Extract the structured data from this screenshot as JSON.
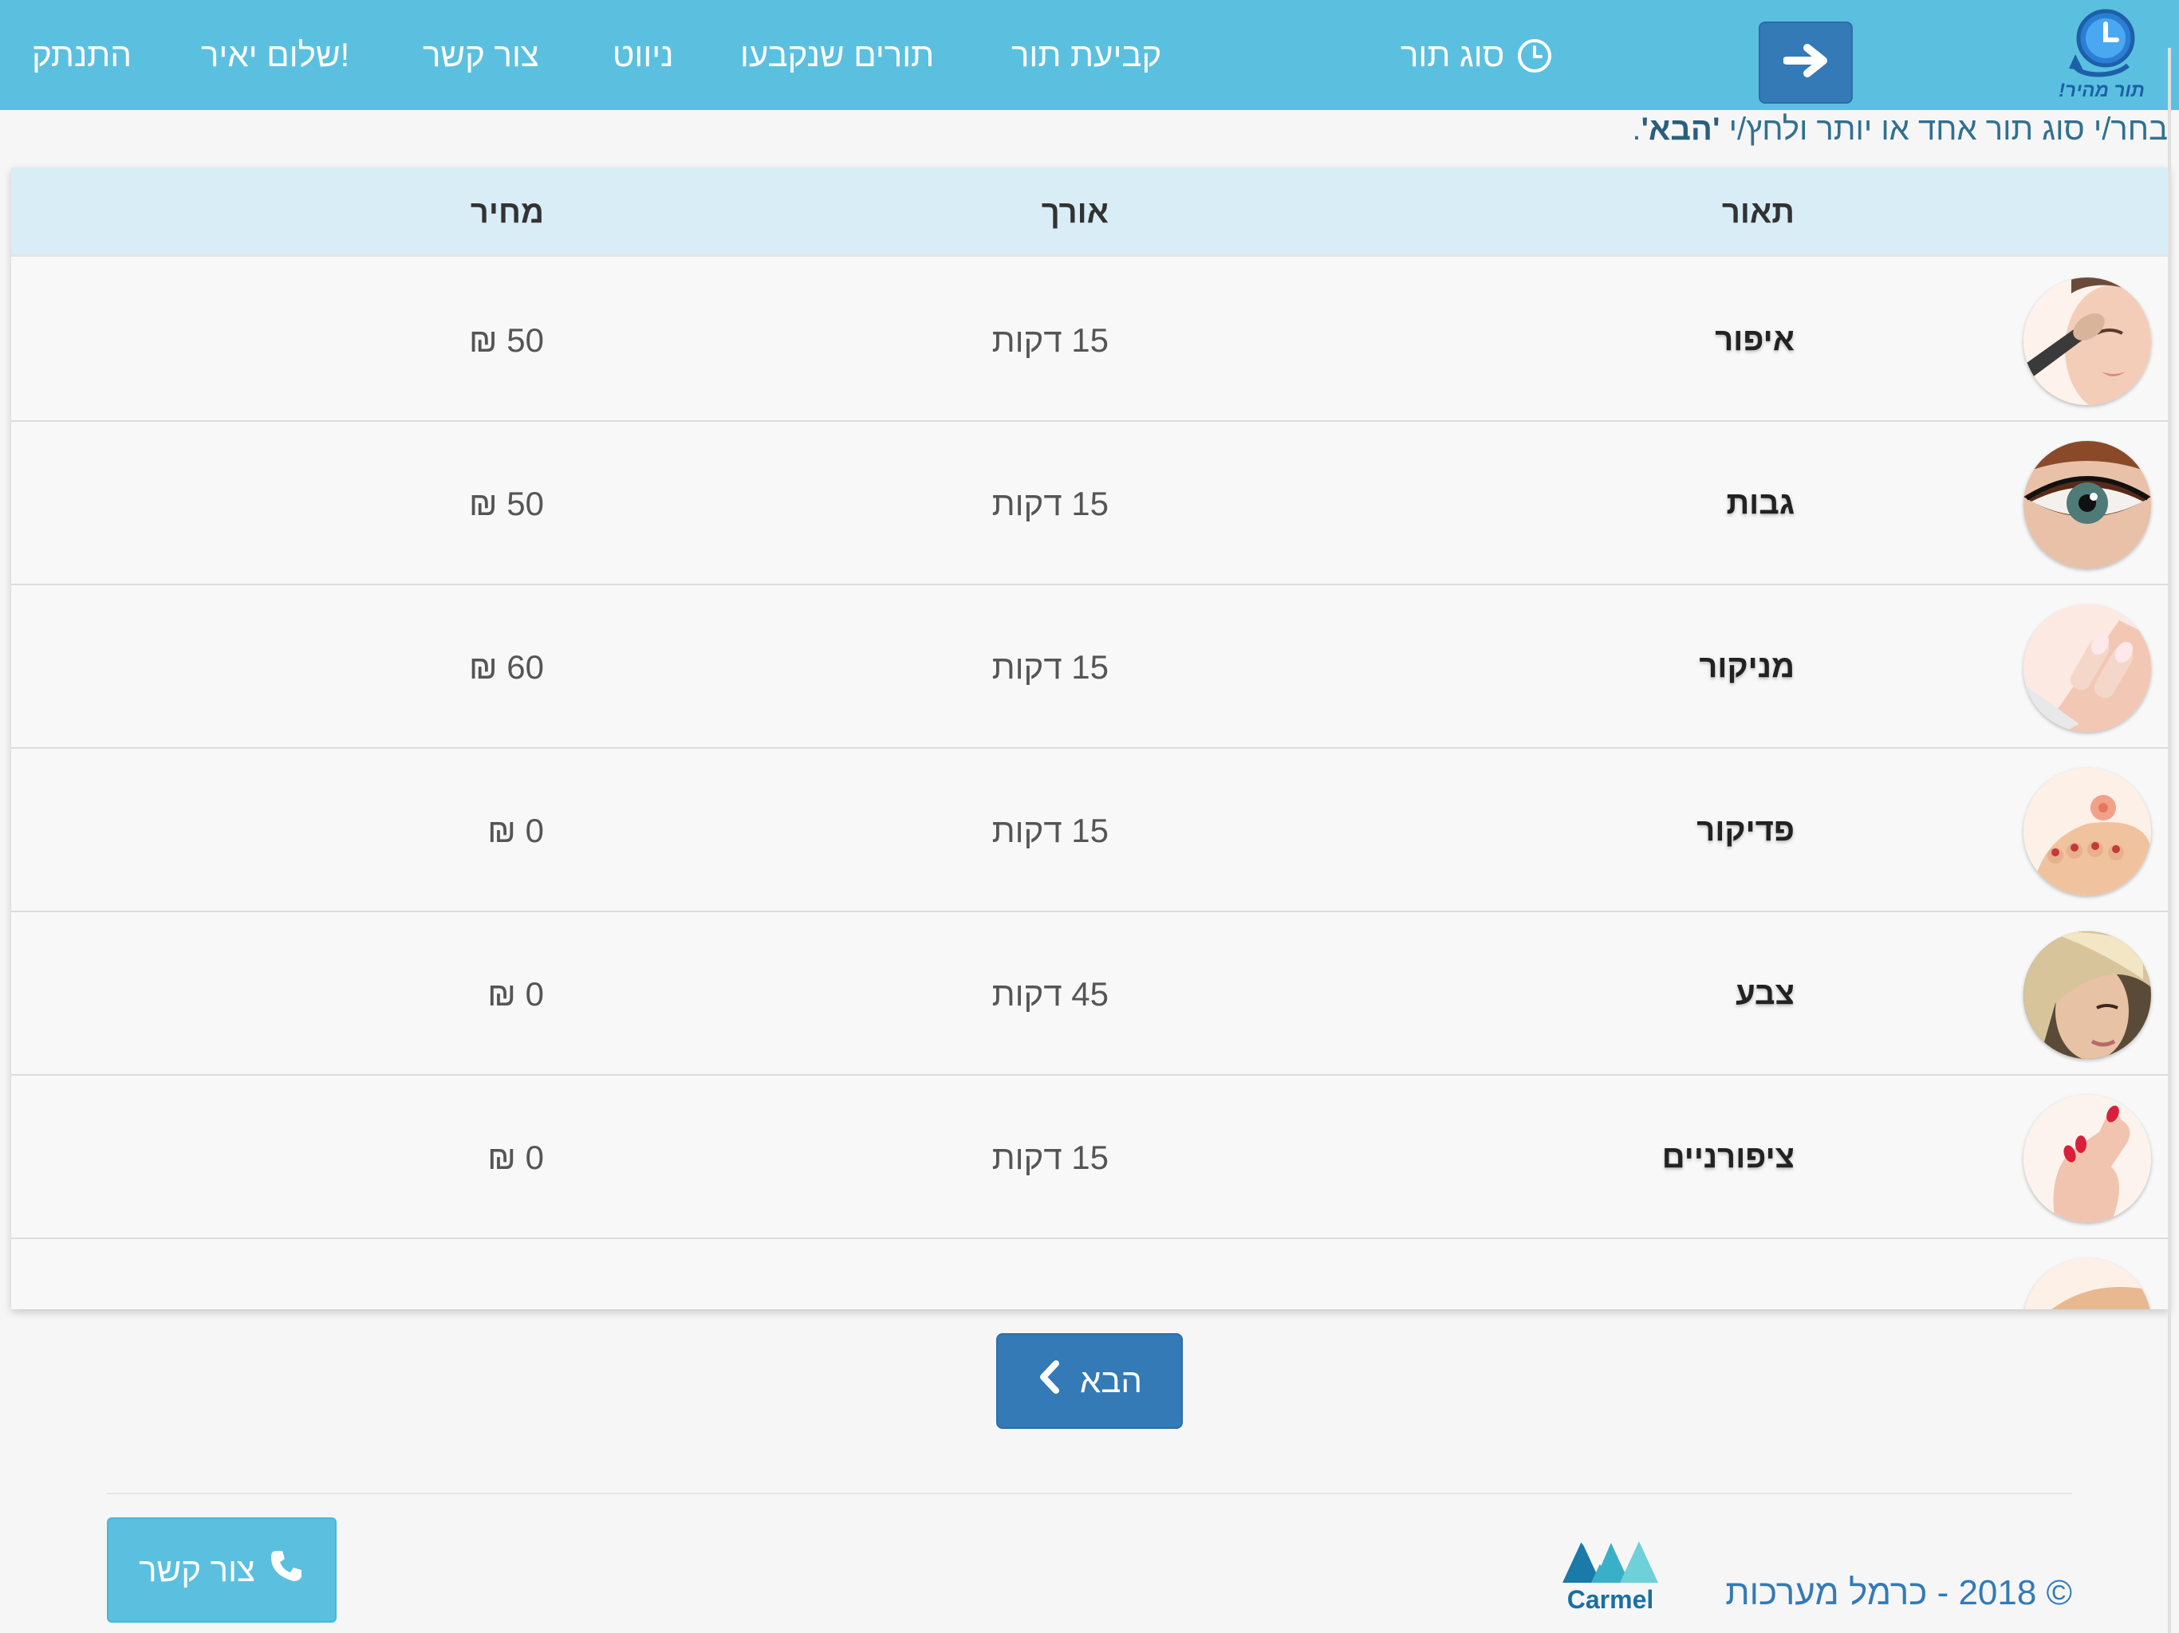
{
  "colors": {
    "navbar": "#5bc0e0",
    "primary_button": "#337ab7",
    "table_header": "#d9edf7",
    "info_text": "#31708f",
    "copyright_text": "#337ab7"
  },
  "logo": {
    "text": "תור מהיר!",
    "icon": "clock-arrow-logo"
  },
  "nav": {
    "back_icon": "arrow-right-icon",
    "current_section": "סוג תור",
    "current_icon": "clock-icon",
    "links": {
      "book": "קביעת תור",
      "booked": "תורים שנקבעו",
      "navigation": "ניווט",
      "contact": "צור קשר",
      "greeting": "שלום יאיר!",
      "logout": "התנתק"
    }
  },
  "instruction": {
    "before": "בחר/י סוג תור אחד או יותר ולחץ/י ",
    "emphasis": "'הבא'",
    "after": "."
  },
  "table": {
    "headers": {
      "description": "תאור",
      "length": "אורך",
      "price": "מחיר"
    },
    "rows": [
      {
        "name": "איפור",
        "length": "15 דקות",
        "price": "50 ₪",
        "image": "makeup-brush-face-image"
      },
      {
        "name": "גבות",
        "length": "15 דקות",
        "price": "50 ₪",
        "image": "eye-makeup-image"
      },
      {
        "name": "מניקור",
        "length": "15 דקות",
        "price": "60 ₪",
        "image": "manicure-hands-image"
      },
      {
        "name": "פדיקור",
        "length": "15 דקות",
        "price": "0 ₪",
        "image": "pedicure-feet-image"
      },
      {
        "name": "צבע",
        "length": "45 דקות",
        "price": "0 ₪",
        "image": "hair-color-woman-image"
      },
      {
        "name": "ציפורניים",
        "length": "15 דקות",
        "price": "0 ₪",
        "image": "painted-nails-hand-image"
      },
      {
        "name": "",
        "length": "",
        "price": "",
        "image": "partial-row-image"
      }
    ]
  },
  "next_button": {
    "label": "הבא",
    "icon": "chevron-left-icon"
  },
  "footer": {
    "contact_label": "צור קשר",
    "contact_icon": "phone-icon",
    "copyright": "© 2018 - כרמל מערכות",
    "brand_logo_text": "Carmel"
  }
}
